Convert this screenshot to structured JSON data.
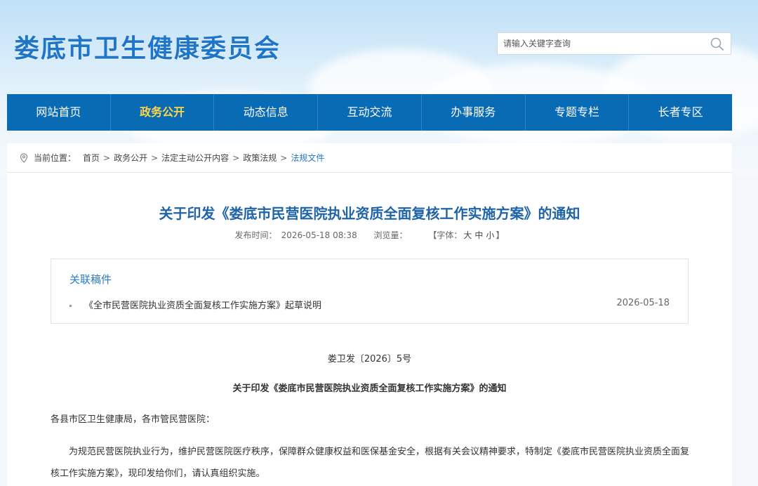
{
  "header": {
    "site_title": "娄底市卫生健康委员会",
    "search": {
      "placeholder": "请输入关键字查询"
    }
  },
  "nav": {
    "items": [
      {
        "label": "网站首页"
      },
      {
        "label": "政务公开"
      },
      {
        "label": "动态信息"
      },
      {
        "label": "互动交流"
      },
      {
        "label": "办事服务"
      },
      {
        "label": "专题专栏"
      },
      {
        "label": "长者专区"
      }
    ],
    "active_index": 1
  },
  "breadcrumb": {
    "prefix": "当前位置：",
    "items": [
      "首页",
      "政务公开",
      "法定主动公开内容",
      "政策法规",
      "法规文件"
    ],
    "separator": ">"
  },
  "article": {
    "title": "关于印发《娄底市民营医院执业资质全面复核工作实施方案》的通知",
    "meta": {
      "publish_label": "发布时间：",
      "publish_time": "2026-05-18 08:38",
      "views_label": "浏览量：",
      "font_label": "【字体：",
      "font_sizes": [
        "大",
        "中",
        "小"
      ],
      "font_close": "】"
    },
    "related": {
      "title": "关联稿件",
      "items": [
        {
          "text": "《全市民营医院执业资质全面复核工作实施方案》起草说明",
          "date": "2026-05-18"
        }
      ]
    },
    "doc_number": "娄卫发〔2026〕5号",
    "subtitle": "关于印发《娄底市民营医院执业资质全面复核工作实施方案》的通知",
    "addressee": "各县市区卫生健康局，各市管民营医院：",
    "paragraph": "为规范民营医院执业行为，维护民营医院医疗秩序，保障群众健康权益和医保基金安全，根据有关会议精神要求，特制定《娄底市民营医院执业资质全面复核工作实施方案》，现印发给你们，请认真组织实施。"
  },
  "colors": {
    "primary_blue": "#0a6bb5",
    "title_blue": "#1f64a8",
    "active_nav": "#ffd54a",
    "site_title": "#1f75c7"
  },
  "icons": {
    "search": "search-icon",
    "location": "location-pin-icon"
  }
}
